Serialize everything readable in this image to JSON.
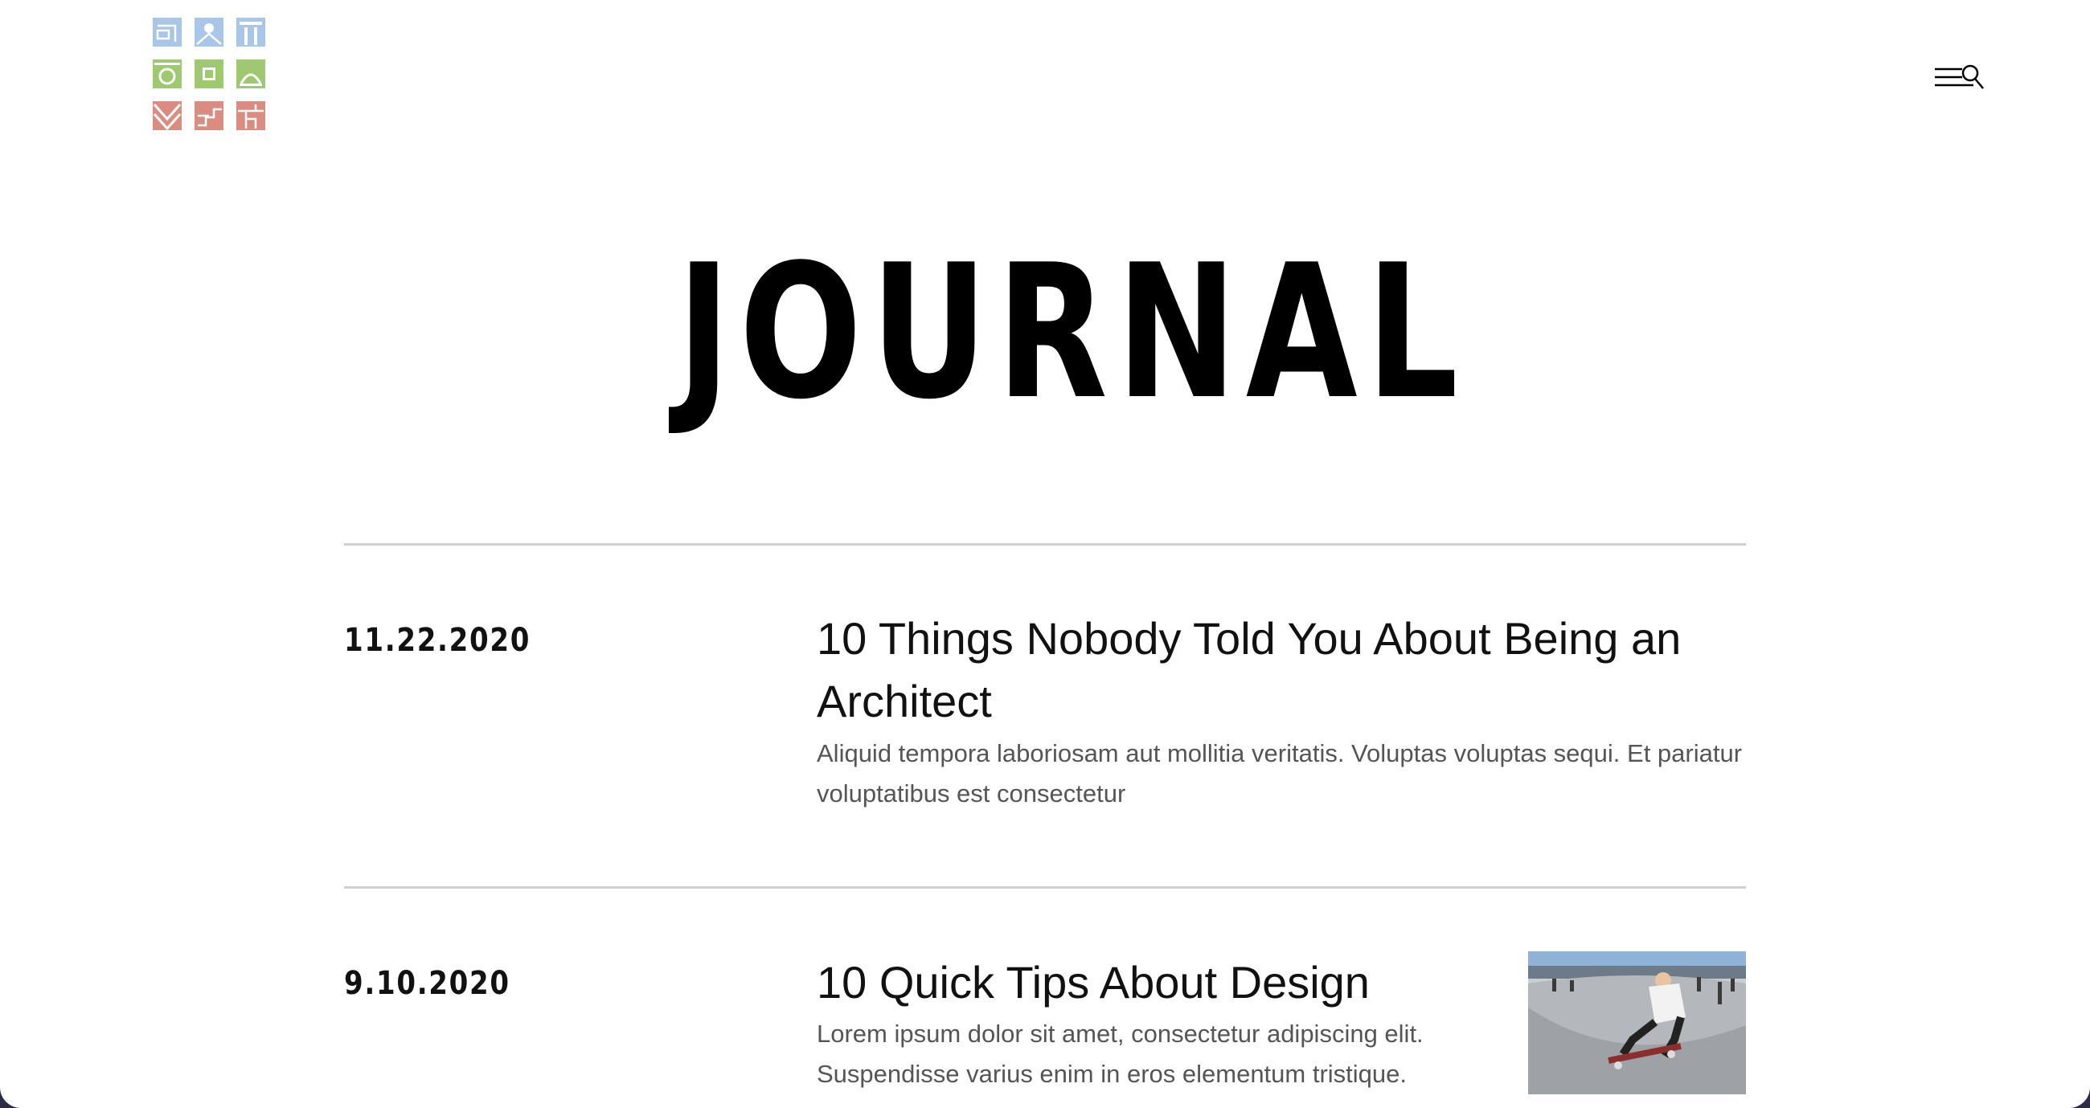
{
  "header": {
    "logo_tiles": [
      {
        "icon": "frame-tile-icon",
        "color": "#a9c6e8"
      },
      {
        "icon": "arch-tile-icon",
        "color": "#a9c6e8"
      },
      {
        "icon": "column-tile-icon",
        "color": "#a9c6e8"
      },
      {
        "icon": "circle-tile-icon",
        "color": "#9ec971"
      },
      {
        "icon": "square-tile-icon",
        "color": "#9ec971"
      },
      {
        "icon": "dome-tile-icon",
        "color": "#9ec971"
      },
      {
        "icon": "chevron-tile-icon",
        "color": "#d98c7f"
      },
      {
        "icon": "stair-tile-icon",
        "color": "#d98c7f"
      },
      {
        "icon": "block-tile-icon",
        "color": "#d98c7f"
      }
    ],
    "menu_icon": "menu-search-icon"
  },
  "page": {
    "title": "JOURNAL"
  },
  "posts": [
    {
      "date": "11.22.2020",
      "title_line1": "10 Things Nobody Told You About Being an",
      "title_line2": "Architect",
      "excerpt_line1": "Aliquid tempora laboriosam aut mollitia veritatis. Voluptas voluptas sequi. Et pariatur",
      "excerpt_line2": "voluptatibus est consectetur"
    },
    {
      "date": "9.10.2020",
      "title_line1": "10 Quick Tips About Design",
      "excerpt_line1": "Lorem ipsum dolor sit amet, consectetur adipiscing elit.",
      "excerpt_line2": "Suspendisse varius enim in eros elementum tristique.",
      "thumbnail": "skateboarder-photo"
    }
  ]
}
